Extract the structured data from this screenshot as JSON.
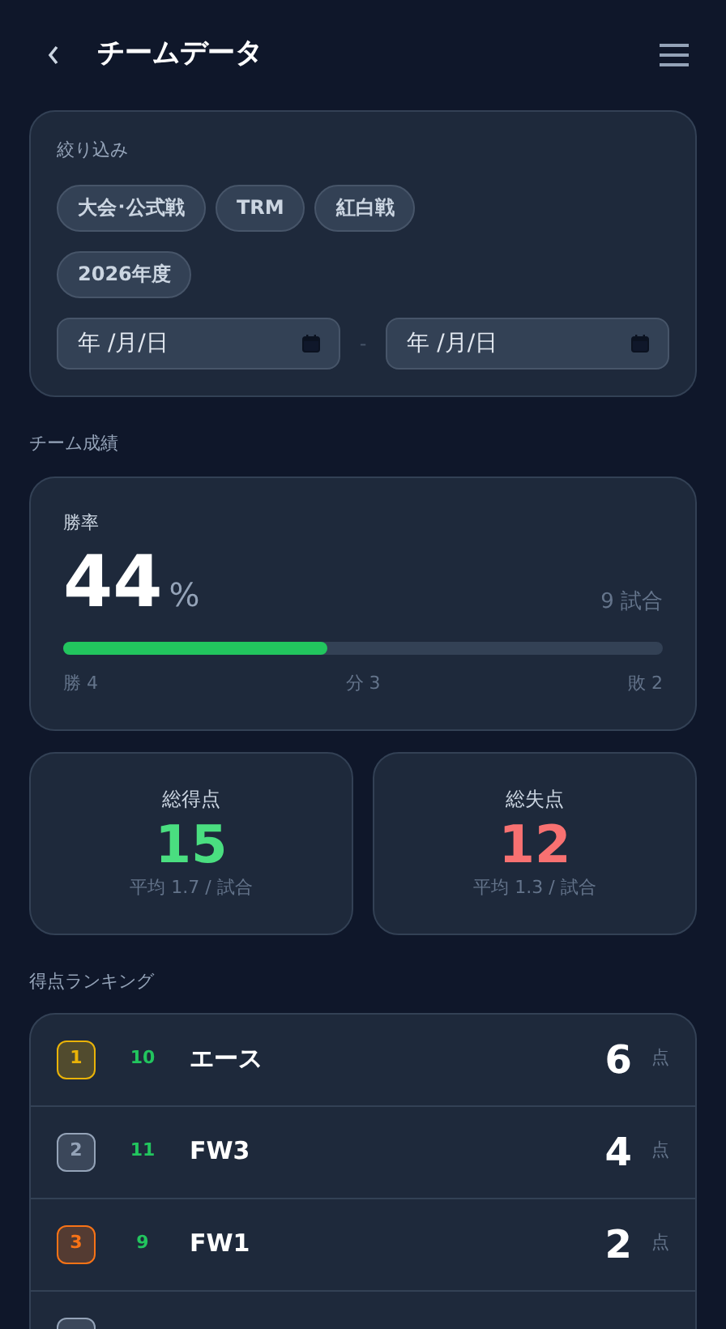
{
  "header": {
    "title": "チームデータ"
  },
  "filter": {
    "title": "絞り込み",
    "chips": [
      {
        "label": "大会･公式戦",
        "selected": false
      },
      {
        "label": "TRM",
        "selected": false
      },
      {
        "label": "紅白戦",
        "selected": false
      },
      {
        "label": "2026年度",
        "selected": false
      }
    ],
    "date_from": {
      "placeholder": "年 /月/日"
    },
    "date_separator": "-",
    "date_to": {
      "placeholder": "年 /月/日"
    }
  },
  "team_record": {
    "title": "チーム成績",
    "win_rate": {
      "label": "勝率",
      "value": "44",
      "unit": "%",
      "games": "9 試合",
      "level": 0.44,
      "wins": "勝 4",
      "draws": "分 3",
      "losses": "敗 2"
    },
    "totals": [
      {
        "label": "総得点",
        "value": "15",
        "average": "平均 1.7 / 試合",
        "color": "#4ade80"
      },
      {
        "label": "総失点",
        "value": "12",
        "average": "平均 1.3 / 試合",
        "color": "#f87171"
      }
    ]
  },
  "ranking": {
    "title": "得点ランキング",
    "rows": [
      {
        "rank": "1",
        "number": "10",
        "name": "エース",
        "goals": "6",
        "unit": "点",
        "color": "#eab308"
      },
      {
        "rank": "2",
        "number": "11",
        "name": "FW3",
        "goals": "4",
        "unit": "点",
        "color": "#94a3b8"
      },
      {
        "rank": "3",
        "number": "9",
        "name": "FW1",
        "goals": "2",
        "unit": "点",
        "color": "#f97316"
      },
      {
        "color": "#94a3b8"
      }
    ]
  }
}
